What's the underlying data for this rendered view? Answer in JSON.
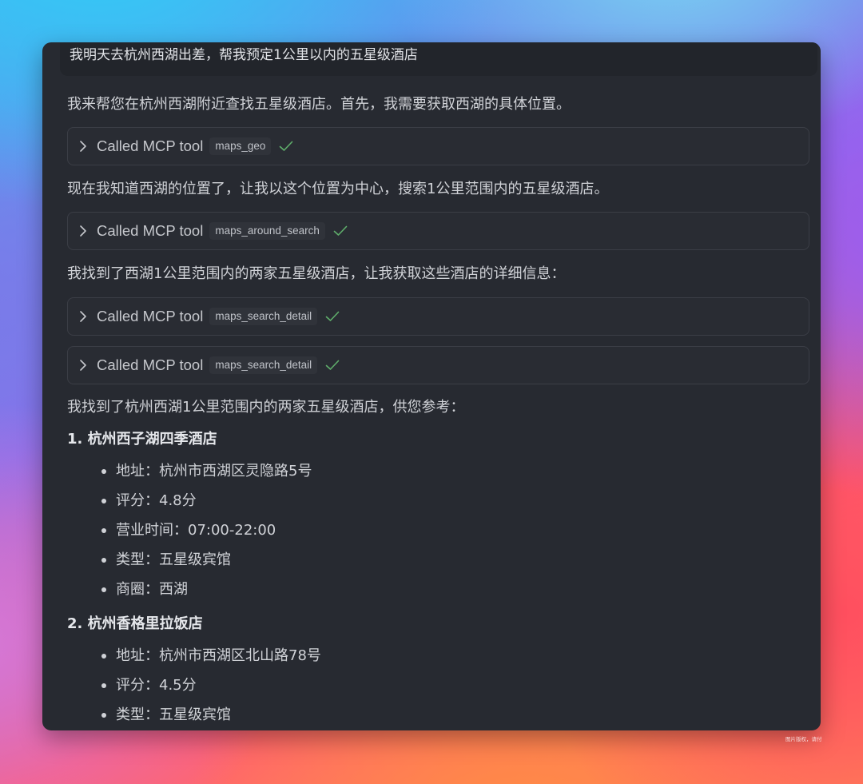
{
  "user_message": "我明天去杭州西湖出差，帮我预定1公里以内的五星级酒店",
  "messages": {
    "p1": "我来帮您在杭州西湖附近查找五星级酒店。首先，我需要获取西湖的具体位置。",
    "p2": "现在我知道西湖的位置了，让我以这个位置为中心，搜索1公里范围内的五星级酒店。",
    "p3": "我找到了西湖1公里范围内的两家五星级酒店，让我获取这些酒店的详细信息：",
    "p4": "我找到了杭州西湖1公里范围内的两家五星级酒店，供您参考："
  },
  "tool_calls": [
    {
      "label": "Called MCP tool",
      "name": "maps_geo"
    },
    {
      "label": "Called MCP tool",
      "name": "maps_around_search"
    },
    {
      "label": "Called MCP tool",
      "name": "maps_search_detail"
    },
    {
      "label": "Called MCP tool",
      "name": "maps_search_detail"
    }
  ],
  "hotels": [
    {
      "title": "1. 杭州西子湖四季酒店",
      "details": [
        "地址：杭州市西湖区灵隐路5号",
        "评分：4.8分",
        "营业时间：07:00-22:00",
        "类型：五星级宾馆",
        "商圈：西湖"
      ]
    },
    {
      "title": "2. 杭州香格里拉饭店",
      "details": [
        "地址：杭州市西湖区北山路78号",
        "评分：4.5分",
        "类型：五星级宾馆"
      ]
    }
  ],
  "watermark": "图片版权，请付",
  "colors": {
    "window_bg": "#272a31",
    "check_green": "#5fae6b"
  },
  "icons": {
    "expand": "chevron-right-icon",
    "done": "check-icon"
  }
}
